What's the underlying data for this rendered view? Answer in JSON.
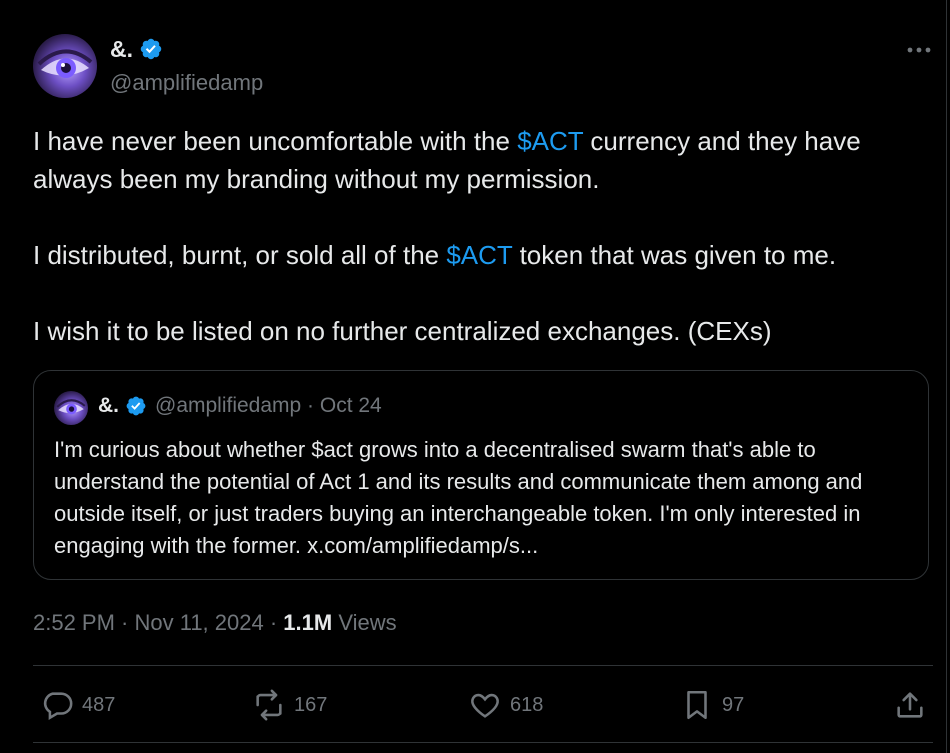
{
  "author": {
    "display_name": "&.",
    "handle": "@amplifiedamp"
  },
  "tweet": {
    "line1_pre": "I have never been uncomfortable with the ",
    "line1_tag": "$ACT",
    "line1_post": " currency and they have always been my branding without my permission.",
    "line2_pre": "I distributed, burnt, or sold all of the ",
    "line2_tag": "$ACT",
    "line2_post": " token that was given to me.",
    "line3": "I wish it to be listed on no further centralized exchanges. (CEXs)"
  },
  "quote": {
    "display_name": "&.",
    "meta": "@amplifiedamp · Oct 24",
    "text": "I'm curious about whether $act grows into a decentralised swarm that's able to understand the potential of Act 1 and its results and communicate them among and outside itself, or just traders buying an interchangeable token. I'm only interested in engaging with the former. x.com/amplifiedamp/s..."
  },
  "meta": {
    "timestamp": "2:52 PM · Nov 11, 2024 · ",
    "views_count": "1.1M",
    "views_label": " Views"
  },
  "actions": {
    "replies": "487",
    "reposts": "167",
    "likes": "618",
    "bookmarks": "97"
  },
  "colors": {
    "accent": "#1d9bf0",
    "text": "#e7e9ea",
    "muted": "#71767b",
    "background": "#000000",
    "border": "#2f3336"
  },
  "icons": [
    "verified-badge-icon",
    "more-icon",
    "reply-icon",
    "repost-icon",
    "like-icon",
    "bookmark-icon",
    "share-icon"
  ]
}
